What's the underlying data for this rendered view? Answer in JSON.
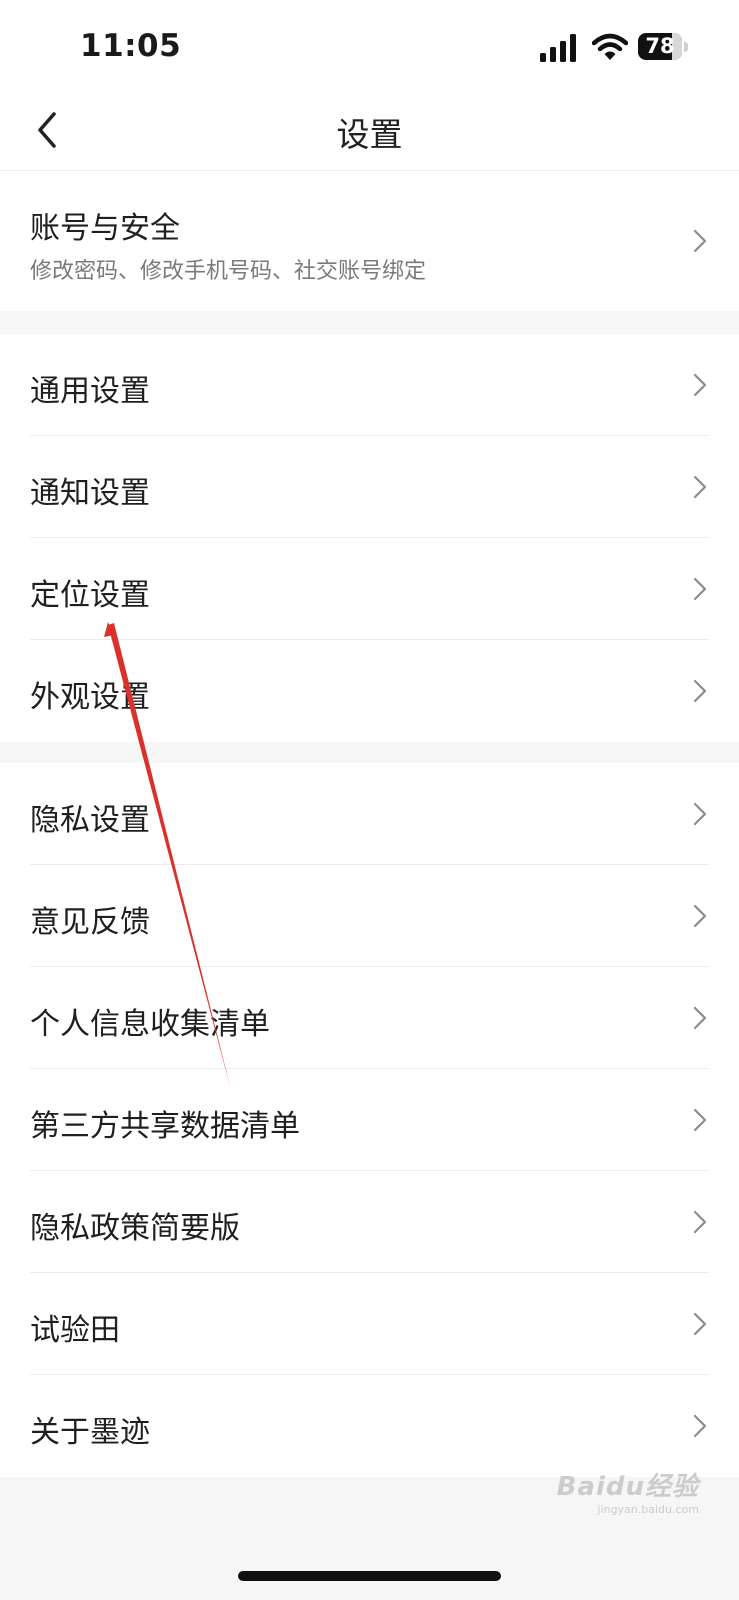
{
  "status_bar": {
    "time": "11:05",
    "battery_level": "78",
    "battery_fraction": 0.78
  },
  "nav": {
    "title": "设置",
    "back_icon": "chevron-left-icon"
  },
  "account": {
    "label": "账号与安全",
    "description": "修改密码、修改手机号码、社交账号绑定"
  },
  "general_group": [
    {
      "label": "通用设置"
    },
    {
      "label": "通知设置"
    },
    {
      "label": "定位设置"
    },
    {
      "label": "外观设置"
    }
  ],
  "info_group": [
    {
      "label": "隐私设置"
    },
    {
      "label": "意见反馈"
    },
    {
      "label": "个人信息收集清单"
    },
    {
      "label": "第三方共享数据清单"
    },
    {
      "label": "隐私政策简要版"
    },
    {
      "label": "试验田"
    },
    {
      "label": "关于墨迹"
    }
  ],
  "watermark": {
    "brand": "Baidu经验",
    "url": "jingyan.baidu.com"
  },
  "colors": {
    "background": "#f6f6f6",
    "row_background": "#ffffff",
    "annotation_arrow": "#d8322b",
    "chevron": "#8c8c8c"
  }
}
